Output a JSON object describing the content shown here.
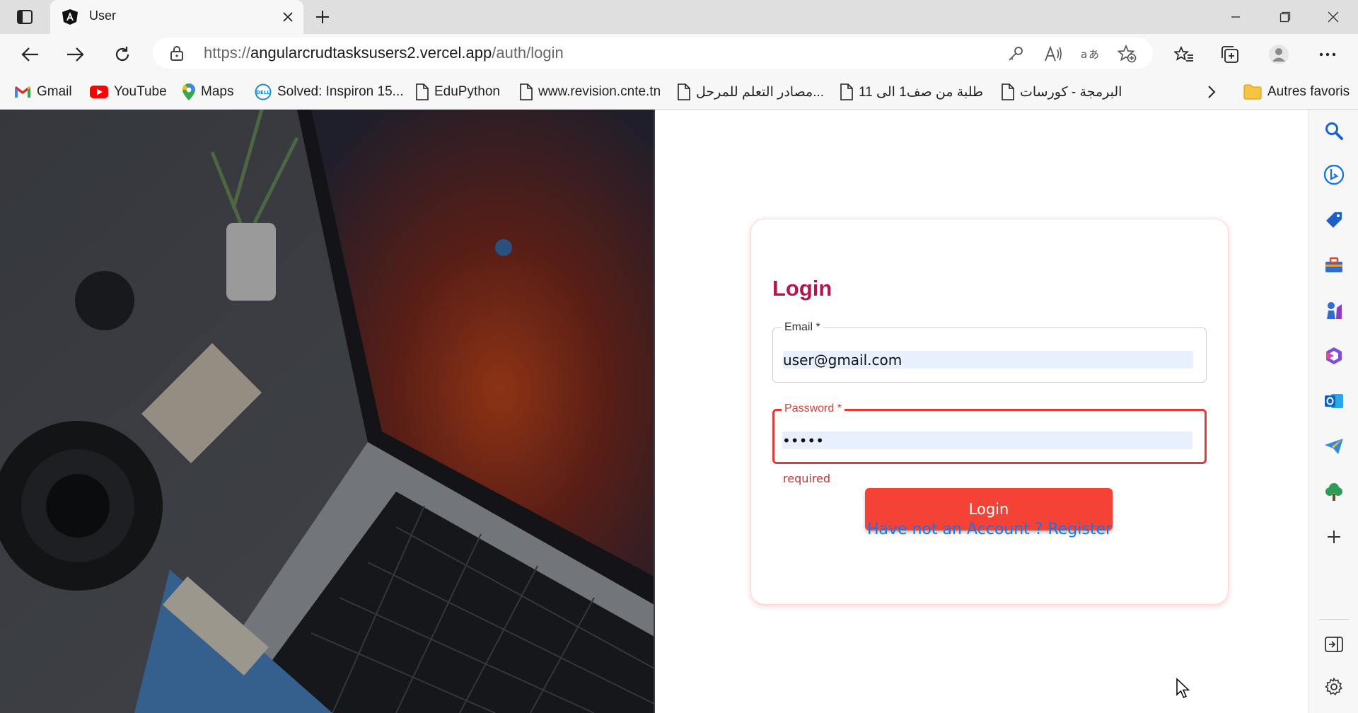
{
  "browser": {
    "tab_title": "User",
    "url_protocol": "https://",
    "url_host": "angularcrudtasksusers2.vercel.app",
    "url_path": "/auth/login"
  },
  "bookmarks": [
    {
      "label": "Gmail",
      "icon": "gmail-icon"
    },
    {
      "label": "YouTube",
      "icon": "youtube-icon"
    },
    {
      "label": "Maps",
      "icon": "maps-icon"
    },
    {
      "label": "Solved: Inspiron 15...",
      "icon": "dell-icon"
    },
    {
      "label": "EduPython",
      "icon": "page-icon"
    },
    {
      "label": "www.revision.cnte.tn",
      "icon": "page-icon"
    },
    {
      "label": "...مصادر التعلم للمرحل",
      "icon": "page-icon"
    },
    {
      "label": "طلبة من صف1 الى 11",
      "icon": "page-icon"
    },
    {
      "label": "البرمجة - كورسات",
      "icon": "page-icon"
    }
  ],
  "bookmarks_other": "Autres favoris",
  "login": {
    "title": "Login",
    "email_label": "Email *",
    "email_value": "user@gmail.com",
    "password_label": "Password *",
    "password_value": "•••••",
    "error": "required",
    "button": "Login",
    "register_link": "Have not an Account ? Register"
  },
  "colors": {
    "title": "#b0174f",
    "button": "#f44336",
    "error": "#e53935",
    "link": "#1a73e8"
  }
}
